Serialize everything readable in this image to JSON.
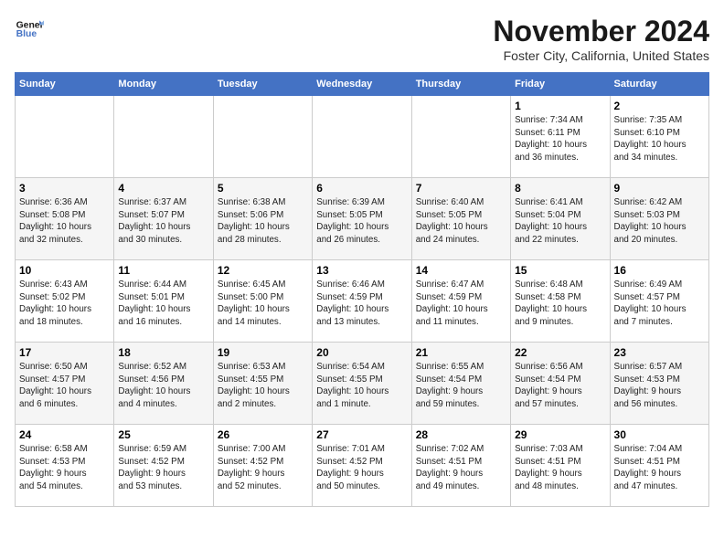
{
  "header": {
    "logo_line1": "General",
    "logo_line2": "Blue",
    "month": "November 2024",
    "location": "Foster City, California, United States"
  },
  "days_of_week": [
    "Sunday",
    "Monday",
    "Tuesday",
    "Wednesday",
    "Thursday",
    "Friday",
    "Saturday"
  ],
  "weeks": [
    [
      {
        "day": "",
        "info": ""
      },
      {
        "day": "",
        "info": ""
      },
      {
        "day": "",
        "info": ""
      },
      {
        "day": "",
        "info": ""
      },
      {
        "day": "",
        "info": ""
      },
      {
        "day": "1",
        "info": "Sunrise: 7:34 AM\nSunset: 6:11 PM\nDaylight: 10 hours\nand 36 minutes."
      },
      {
        "day": "2",
        "info": "Sunrise: 7:35 AM\nSunset: 6:10 PM\nDaylight: 10 hours\nand 34 minutes."
      }
    ],
    [
      {
        "day": "3",
        "info": "Sunrise: 6:36 AM\nSunset: 5:08 PM\nDaylight: 10 hours\nand 32 minutes."
      },
      {
        "day": "4",
        "info": "Sunrise: 6:37 AM\nSunset: 5:07 PM\nDaylight: 10 hours\nand 30 minutes."
      },
      {
        "day": "5",
        "info": "Sunrise: 6:38 AM\nSunset: 5:06 PM\nDaylight: 10 hours\nand 28 minutes."
      },
      {
        "day": "6",
        "info": "Sunrise: 6:39 AM\nSunset: 5:05 PM\nDaylight: 10 hours\nand 26 minutes."
      },
      {
        "day": "7",
        "info": "Sunrise: 6:40 AM\nSunset: 5:05 PM\nDaylight: 10 hours\nand 24 minutes."
      },
      {
        "day": "8",
        "info": "Sunrise: 6:41 AM\nSunset: 5:04 PM\nDaylight: 10 hours\nand 22 minutes."
      },
      {
        "day": "9",
        "info": "Sunrise: 6:42 AM\nSunset: 5:03 PM\nDaylight: 10 hours\nand 20 minutes."
      }
    ],
    [
      {
        "day": "10",
        "info": "Sunrise: 6:43 AM\nSunset: 5:02 PM\nDaylight: 10 hours\nand 18 minutes."
      },
      {
        "day": "11",
        "info": "Sunrise: 6:44 AM\nSunset: 5:01 PM\nDaylight: 10 hours\nand 16 minutes."
      },
      {
        "day": "12",
        "info": "Sunrise: 6:45 AM\nSunset: 5:00 PM\nDaylight: 10 hours\nand 14 minutes."
      },
      {
        "day": "13",
        "info": "Sunrise: 6:46 AM\nSunset: 4:59 PM\nDaylight: 10 hours\nand 13 minutes."
      },
      {
        "day": "14",
        "info": "Sunrise: 6:47 AM\nSunset: 4:59 PM\nDaylight: 10 hours\nand 11 minutes."
      },
      {
        "day": "15",
        "info": "Sunrise: 6:48 AM\nSunset: 4:58 PM\nDaylight: 10 hours\nand 9 minutes."
      },
      {
        "day": "16",
        "info": "Sunrise: 6:49 AM\nSunset: 4:57 PM\nDaylight: 10 hours\nand 7 minutes."
      }
    ],
    [
      {
        "day": "17",
        "info": "Sunrise: 6:50 AM\nSunset: 4:57 PM\nDaylight: 10 hours\nand 6 minutes."
      },
      {
        "day": "18",
        "info": "Sunrise: 6:52 AM\nSunset: 4:56 PM\nDaylight: 10 hours\nand 4 minutes."
      },
      {
        "day": "19",
        "info": "Sunrise: 6:53 AM\nSunset: 4:55 PM\nDaylight: 10 hours\nand 2 minutes."
      },
      {
        "day": "20",
        "info": "Sunrise: 6:54 AM\nSunset: 4:55 PM\nDaylight: 10 hours\nand 1 minute."
      },
      {
        "day": "21",
        "info": "Sunrise: 6:55 AM\nSunset: 4:54 PM\nDaylight: 9 hours\nand 59 minutes."
      },
      {
        "day": "22",
        "info": "Sunrise: 6:56 AM\nSunset: 4:54 PM\nDaylight: 9 hours\nand 57 minutes."
      },
      {
        "day": "23",
        "info": "Sunrise: 6:57 AM\nSunset: 4:53 PM\nDaylight: 9 hours\nand 56 minutes."
      }
    ],
    [
      {
        "day": "24",
        "info": "Sunrise: 6:58 AM\nSunset: 4:53 PM\nDaylight: 9 hours\nand 54 minutes."
      },
      {
        "day": "25",
        "info": "Sunrise: 6:59 AM\nSunset: 4:52 PM\nDaylight: 9 hours\nand 53 minutes."
      },
      {
        "day": "26",
        "info": "Sunrise: 7:00 AM\nSunset: 4:52 PM\nDaylight: 9 hours\nand 52 minutes."
      },
      {
        "day": "27",
        "info": "Sunrise: 7:01 AM\nSunset: 4:52 PM\nDaylight: 9 hours\nand 50 minutes."
      },
      {
        "day": "28",
        "info": "Sunrise: 7:02 AM\nSunset: 4:51 PM\nDaylight: 9 hours\nand 49 minutes."
      },
      {
        "day": "29",
        "info": "Sunrise: 7:03 AM\nSunset: 4:51 PM\nDaylight: 9 hours\nand 48 minutes."
      },
      {
        "day": "30",
        "info": "Sunrise: 7:04 AM\nSunset: 4:51 PM\nDaylight: 9 hours\nand 47 minutes."
      }
    ]
  ]
}
